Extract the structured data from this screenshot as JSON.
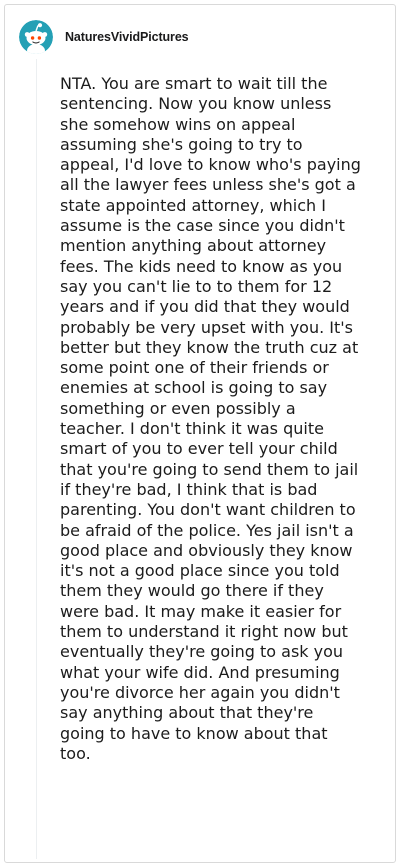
{
  "comment": {
    "username": "NaturesVividPictures",
    "avatar_icon": "snoo-avatar-icon",
    "avatar_bg": "#24a0b5",
    "body": "NTA. You are smart to wait till the sentencing. Now you know unless she somehow wins on appeal assuming she's going to try to appeal, I'd love to know who's paying all the lawyer fees unless she's got a state appointed attorney, which I assume is the case since you didn't mention anything about attorney fees. The kids need to know as you say you can't lie to to them for 12 years and if you did that they would probably be very upset with you. It's better but they know the truth cuz at some point one of their friends or enemies at school is going to say something or even possibly a teacher. I don't think it was quite smart of you to ever tell your child that you're going to send them to jail if they're bad, I think that is bad parenting. You don't want children to be afraid of the police. Yes jail isn't a good place and obviously they know it's not a good place since you told them they would go there if they were bad. It may make it easier for them to understand it right now but eventually they're going to ask you what your wife did. And presuming you're divorce her again you didn't say anything about that they're going to have to know about that too."
  }
}
